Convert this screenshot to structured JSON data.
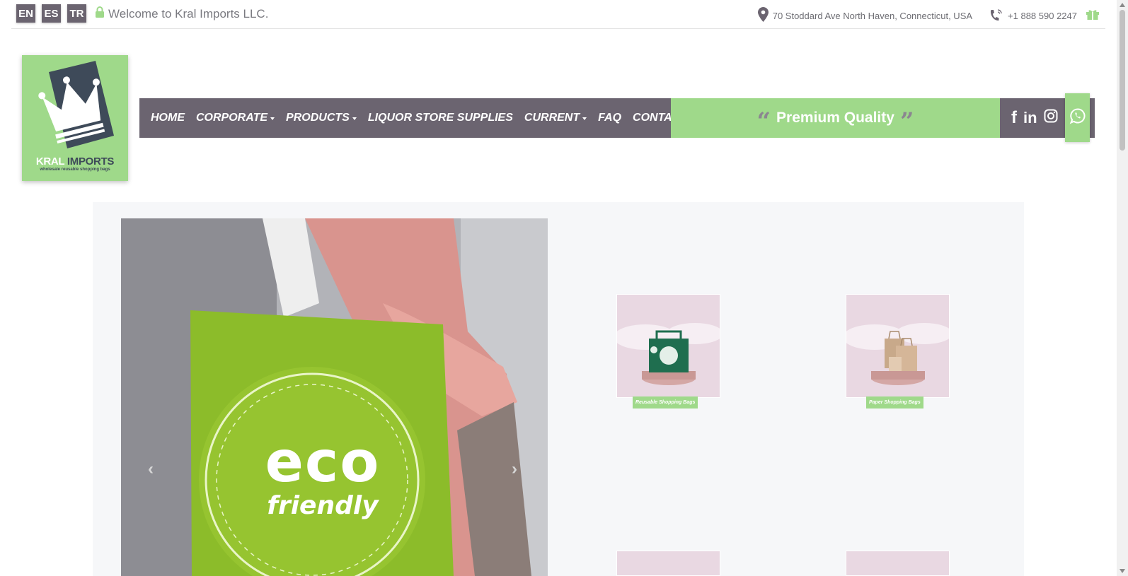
{
  "topbar": {
    "languages": [
      "EN",
      "ES",
      "TR"
    ],
    "welcome": "Welcome to Kral Imports LLC.",
    "address": "70 Stoddard Ave North Haven, Connecticut, USA",
    "phone": "+1 888 590 2247"
  },
  "logo": {
    "brand_first": "KRAL",
    "brand_second": "IMPORTS",
    "tagline": "wholesale reusable shopping bags"
  },
  "nav": {
    "home": "HOME",
    "corporate": "CORPORATE",
    "products": "PRODUCTS",
    "liquor": "LIQUOR STORE SUPPLIES",
    "current": "CURRENT",
    "faq": "FAQ",
    "contact": "CONTACT"
  },
  "banner": {
    "open_quote": "“",
    "text": "Premium Quality",
    "close_quote": "”"
  },
  "social": {
    "facebook": "f",
    "linkedin": "in"
  },
  "hero": {
    "line1": "eco",
    "line2": "friendly",
    "prev": "‹",
    "next": "›"
  },
  "products": [
    {
      "label": "Reusable Shopping Bags"
    },
    {
      "label": "Paper Shopping Bags"
    }
  ],
  "colors": {
    "accent_green": "#9fd98a",
    "nav_gray": "#6b6470",
    "panel_bg": "#f6f7f9"
  },
  "icons": [
    "lock-icon",
    "map-pin-icon",
    "phone-icon",
    "gift-icon",
    "facebook-icon",
    "linkedin-icon",
    "instagram-icon",
    "whatsapp-icon",
    "crown-icon"
  ]
}
